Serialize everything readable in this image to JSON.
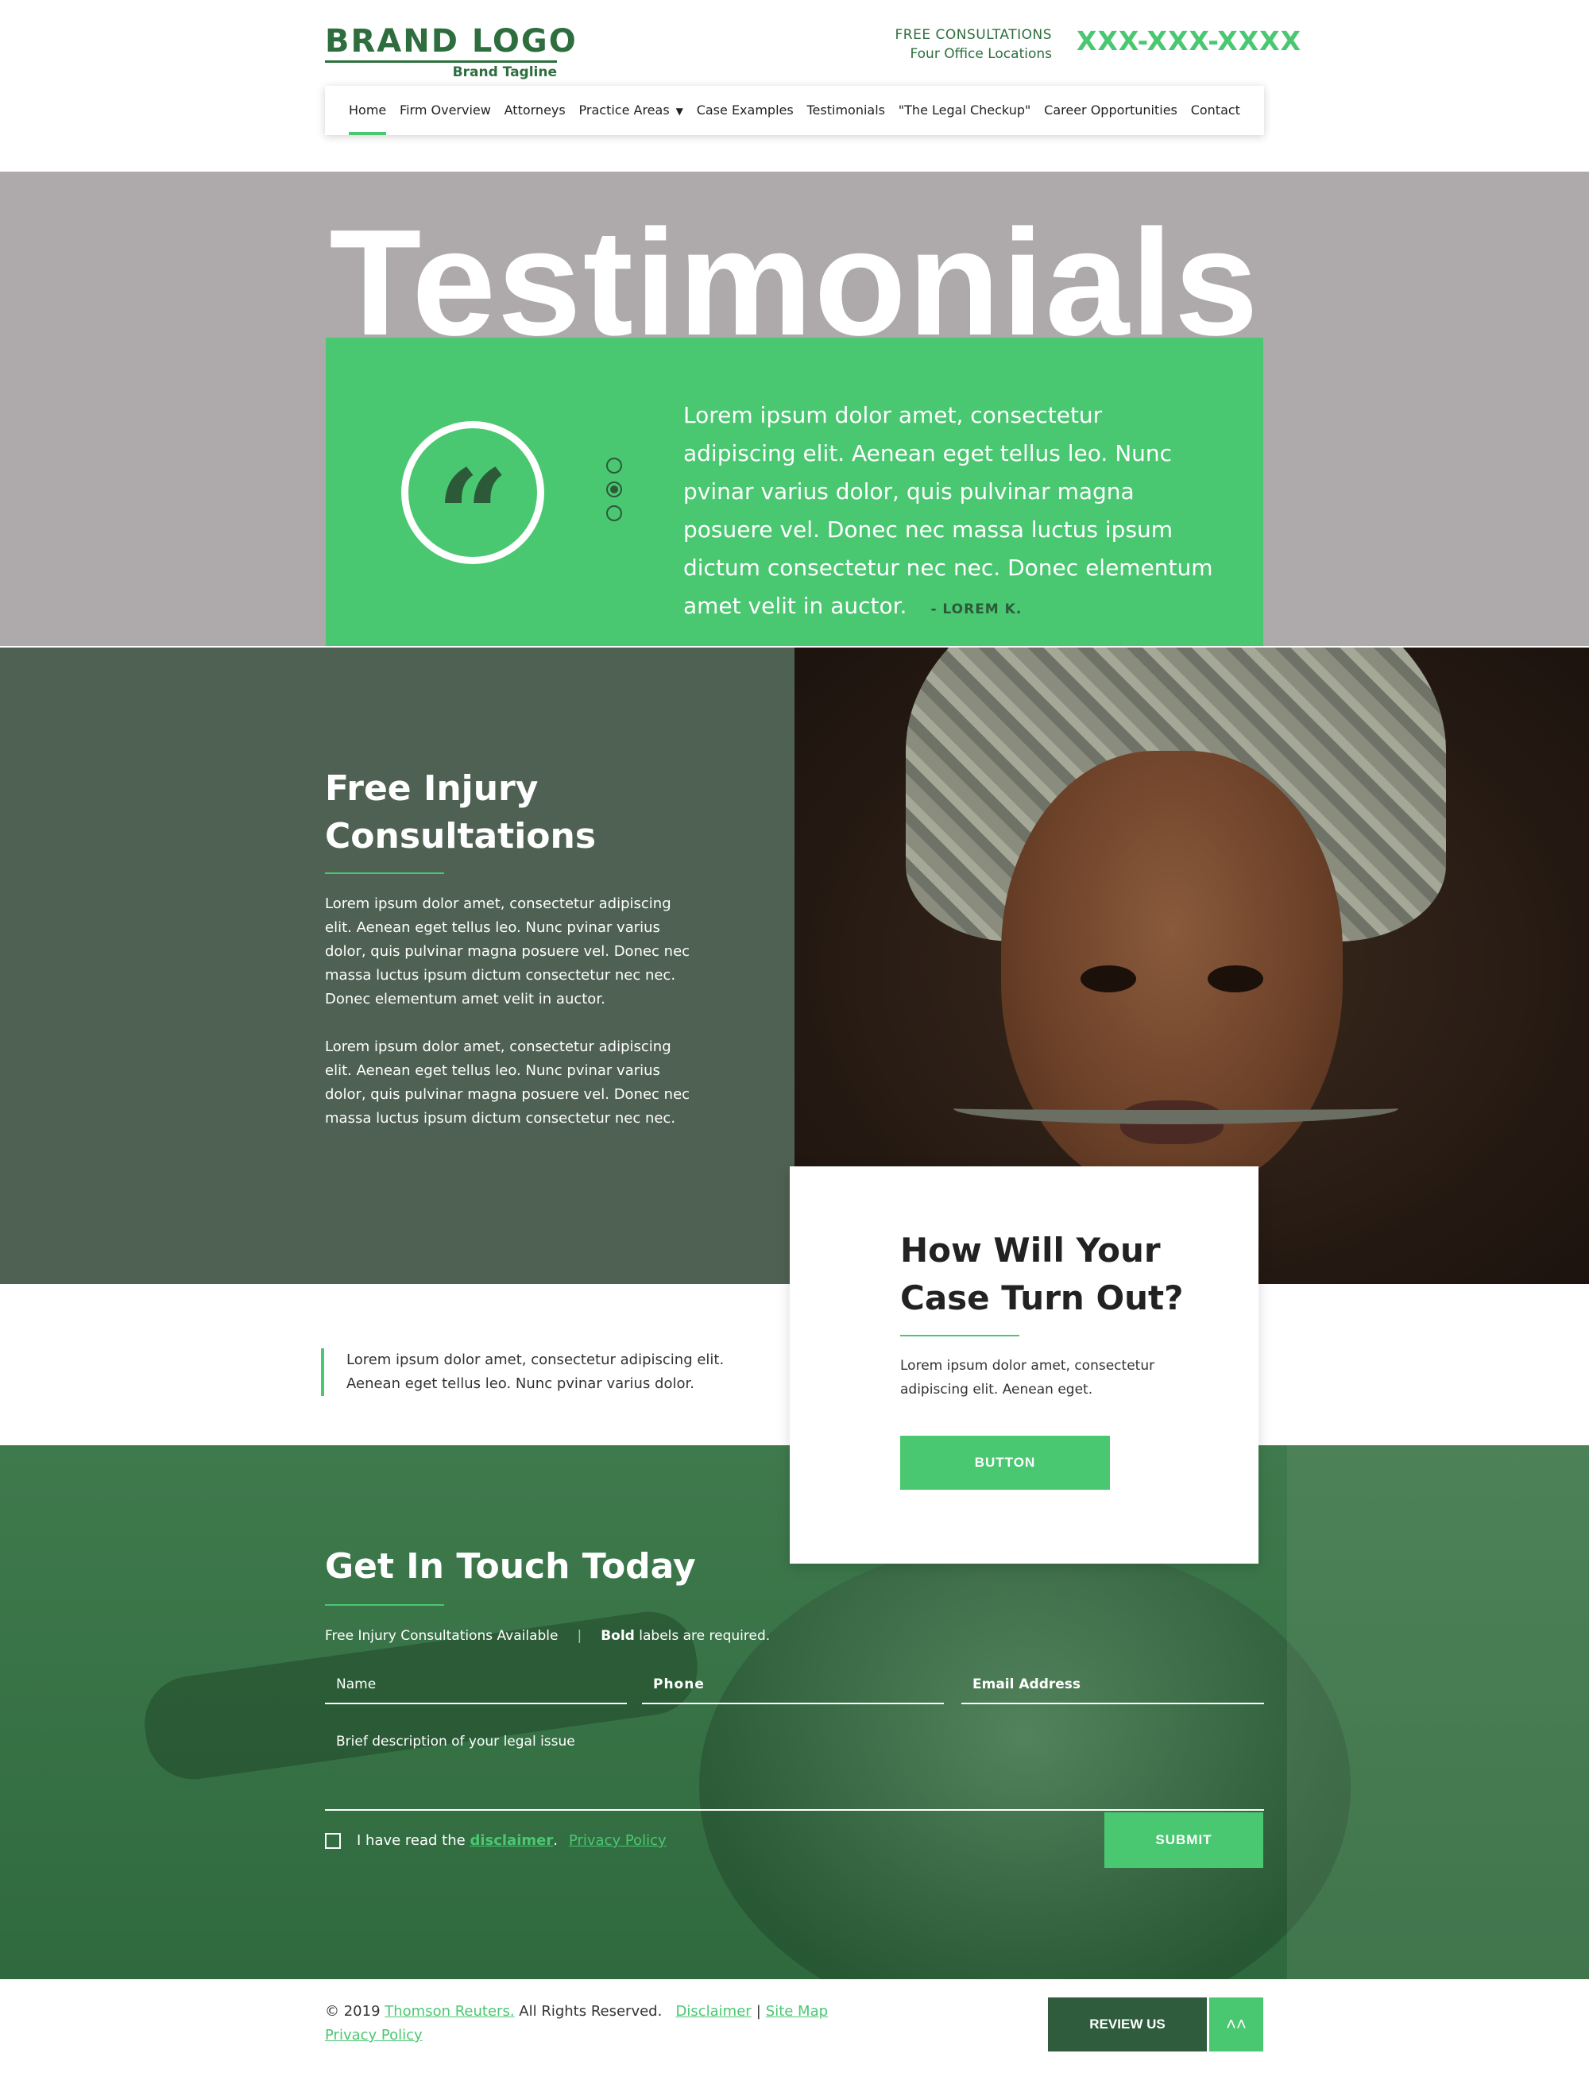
{
  "brand": {
    "logo": "BRAND LOGO",
    "tagline": "Brand Tagline"
  },
  "top_contact": {
    "line1": "FREE CONSULTATIONS",
    "line2": "Four Office Locations",
    "phone": "XXX-XXX-XXXX"
  },
  "nav": {
    "items": [
      {
        "label": "Home",
        "active": true
      },
      {
        "label": "Firm Overview"
      },
      {
        "label": "Attorneys"
      },
      {
        "label": "Practice Areas",
        "dropdown": true
      },
      {
        "label": "Case Examples"
      },
      {
        "label": "Testimonials"
      },
      {
        "label": "\"The Legal Checkup\""
      },
      {
        "label": "Career Opportunities"
      },
      {
        "label": "Contact"
      }
    ]
  },
  "hero": {
    "title": "Testimonials",
    "quote_glyph": "“",
    "quote": "Lorem ipsum dolor amet, consectetur adipiscing elit. Aenean eget tellus leo. Nunc pvinar varius dolor, quis pulvinar magna posuere vel. Donec nec massa luctus ipsum dictum consectetur nec nec. Donec elementum amet velit in auctor.",
    "author": "- LOREM K.",
    "slider_active_index": 1
  },
  "consult": {
    "title": "Free Injury Consultations",
    "p1": "Lorem ipsum dolor amet, consectetur adipiscing elit. Aenean eget tellus leo. Nunc pvinar varius dolor, quis pulvinar magna posuere vel. Donec nec massa luctus ipsum dictum consectetur nec nec. Donec elementum amet velit in auctor.",
    "p2": "Lorem ipsum dolor amet, consectetur adipiscing elit. Aenean eget tellus leo. Nunc pvinar varius dolor, quis pulvinar magna posuere vel. Donec nec massa luctus ipsum dictum consectetur nec nec."
  },
  "case_card": {
    "title": "How Will Your Case Turn Out?",
    "text": "Lorem ipsum dolor amet, consectetur adipiscing elit. Aenean eget.",
    "button": "BUTTON"
  },
  "blurb": "Lorem ipsum dolor amet, consectetur adipiscing elit. Aenean eget tellus leo. Nunc pvinar varius dolor.",
  "form": {
    "title": "Get In Touch Today",
    "info_left": "Free Injury Consultations Available",
    "info_sep": "|",
    "info_bold": "Bold",
    "info_right": " labels are required.",
    "name_placeholder": "Name",
    "phone_placeholder": "Phone",
    "email_placeholder": "Email Address",
    "desc_placeholder": "Brief description of your legal issue",
    "check_prefix": "I have read the ",
    "disclaimer_link": "disclaimer",
    "check_dot": ".",
    "privacy_link": "Privacy Policy",
    "submit": "SUBMIT"
  },
  "footer": {
    "copyright_prefix": "© 2019 ",
    "company_link": "Thomson Reuters.",
    "rights": " All Rights Reserved.",
    "disclaimer_link": "Disclaimer",
    "pipe": "|",
    "sitemap_link": "Site Map",
    "privacy_link": "Privacy Policy",
    "review_button": "REVIEW US",
    "top_icon": "˄˄"
  },
  "colors": {
    "accent": "#4ac771",
    "dark_green": "#2e6e3e",
    "hero_bg": "#aeaaab",
    "consult_bg": "#4e6152"
  }
}
